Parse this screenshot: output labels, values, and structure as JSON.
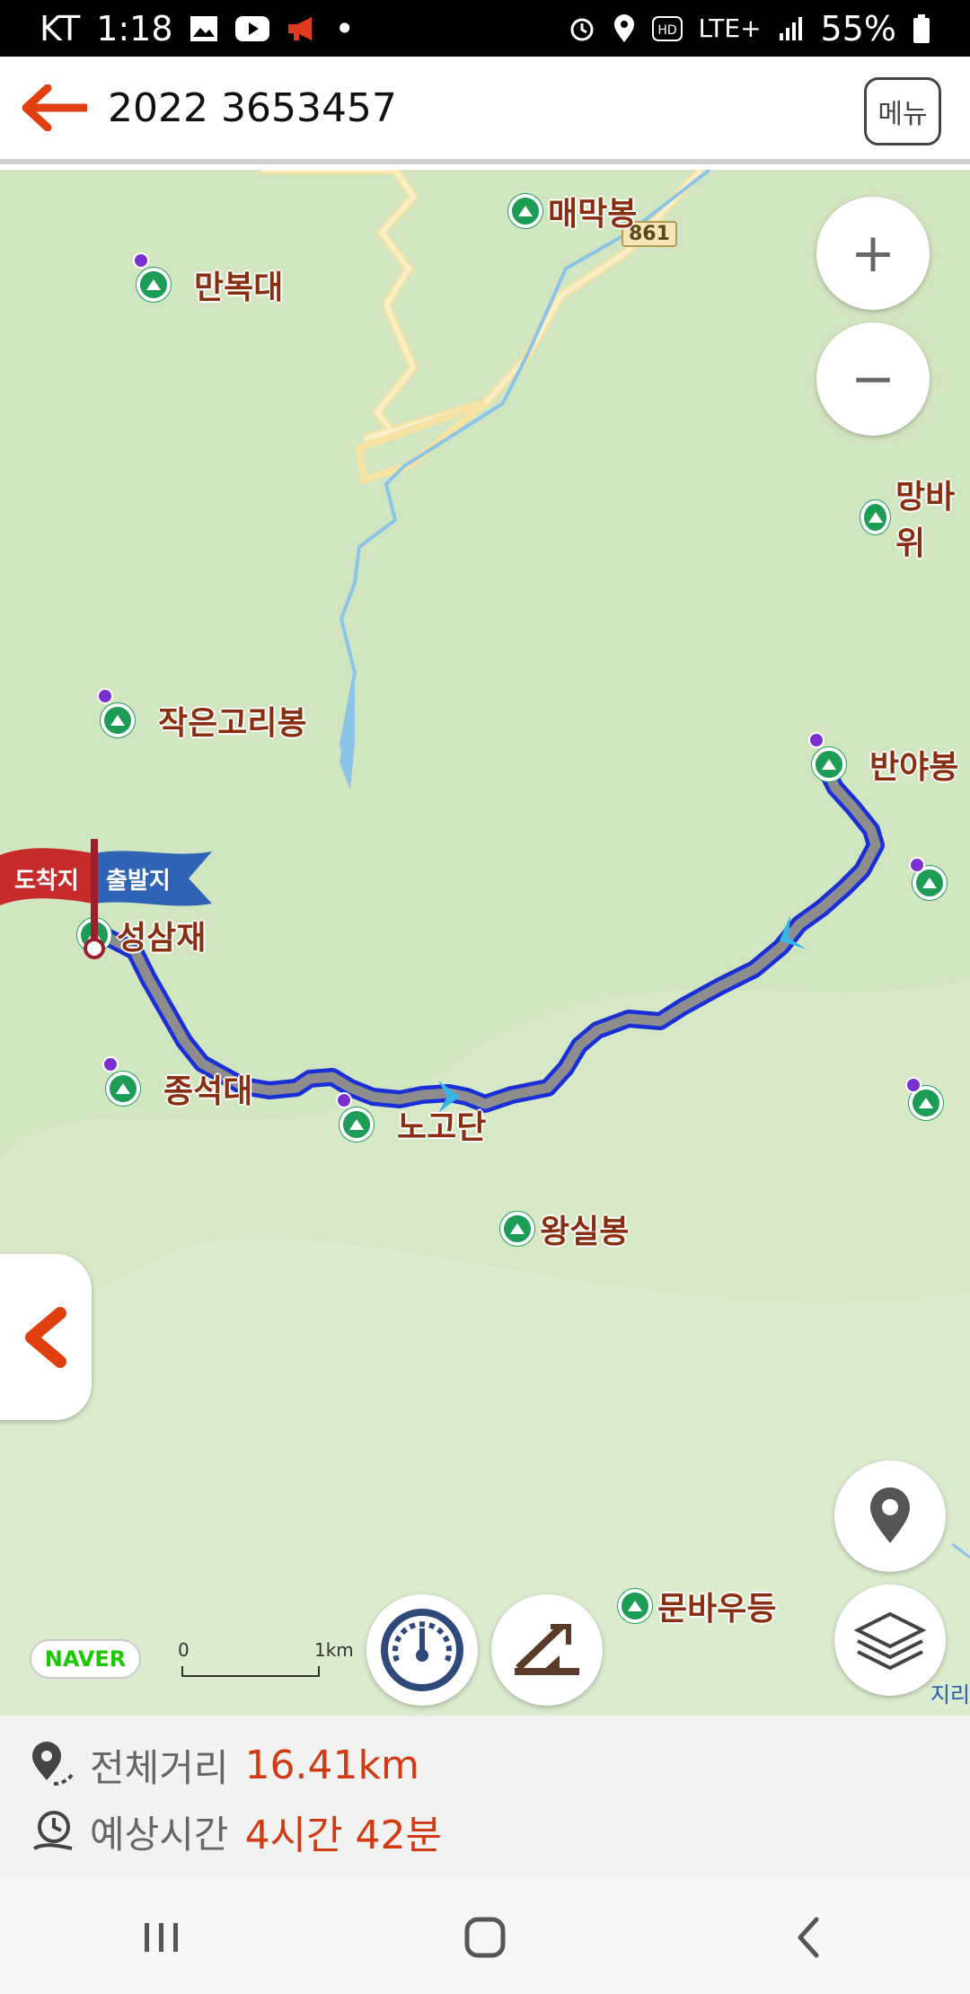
{
  "status_bar": {
    "carrier": "KT",
    "time": "1:18",
    "network": "LTE+",
    "battery": "55%"
  },
  "app_bar": {
    "title": "2022 3653457",
    "menu_label": "메뉴"
  },
  "map": {
    "places": [
      {
        "name": "매막봉"
      },
      {
        "name": "만복대"
      },
      {
        "name": "망바위"
      },
      {
        "name": "작은고리봉"
      },
      {
        "name": "반야봉"
      },
      {
        "name": "성삼재"
      },
      {
        "name": "종석대"
      },
      {
        "name": "노고단"
      },
      {
        "name": "왕실봉"
      },
      {
        "name": "문바우등"
      }
    ],
    "road_number": "861",
    "flag": {
      "end_label": "도착지",
      "start_label": "출발지"
    },
    "zoom_in_label": "+",
    "zoom_out_label": "−",
    "naver_logo": "NAVER",
    "scale": {
      "start": "0",
      "end": "1km"
    },
    "attribution": "지리",
    "route_color": "#1a2fd6",
    "land_color": "#d6e8c6"
  },
  "info": {
    "distance_label": "전체거리",
    "distance_value": "16.41km",
    "time_label": "예상시간",
    "time_value": "4시간 42분"
  },
  "icons": [
    "back-arrow-icon",
    "zoom-in-icon",
    "zoom-out-icon",
    "collapse-chevron-icon",
    "speedometer-icon",
    "elevation-icon",
    "location-pin-icon",
    "layers-icon",
    "distance-pin-icon",
    "clock-icon",
    "recents-icon",
    "home-icon",
    "back-nav-icon"
  ]
}
